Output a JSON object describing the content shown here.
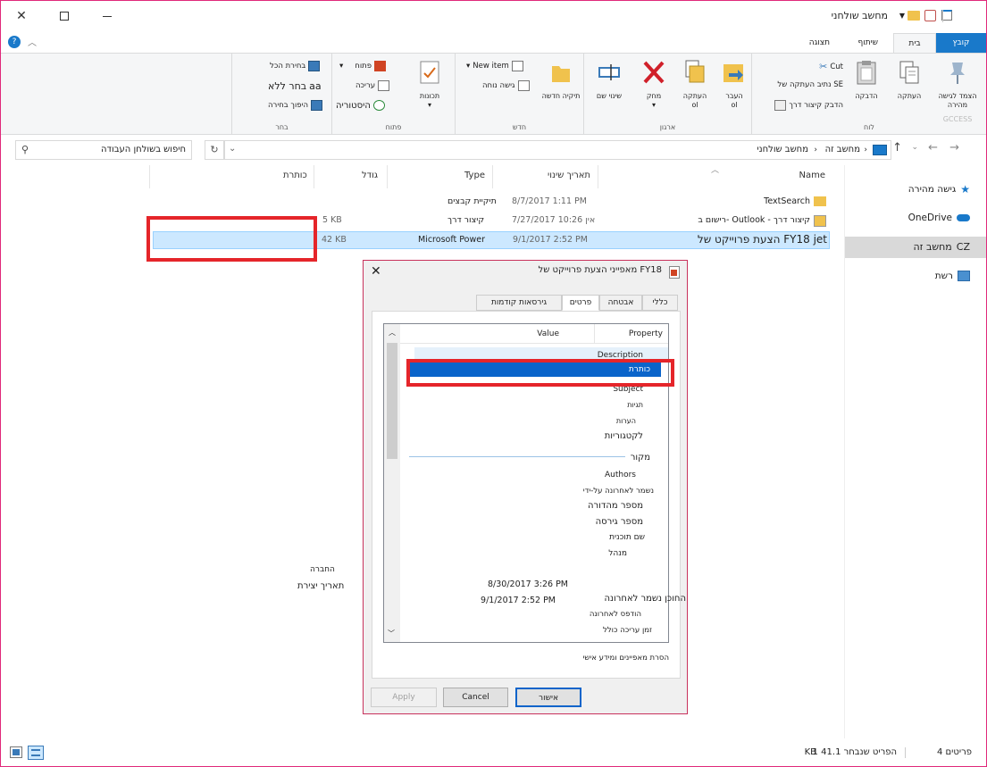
{
  "window": {
    "title": "מחשב שולחני"
  },
  "ribbon_tabs": [
    "קובץ",
    "בית",
    "שיתוף",
    "תצוגה"
  ],
  "ribbon": {
    "clipboard": {
      "pin_label": "הצמד לגישה מהירה",
      "copy_label": "העתקה",
      "paste_label": "הדבקה",
      "cut_label": "Cut",
      "copy_path_label": "נתיב העתקה של SE",
      "paste_shortcut_label": "הדבק קיצור דרך",
      "group_label": "לוח",
      "faded_code": "GCCESS"
    },
    "organize": {
      "move_label": "העבר",
      "move_to_label": "ol",
      "copy_to_label": "העתקה",
      "copy_to_sub": "ol",
      "delete_label": "מחק",
      "rename_label": "שינוי שם",
      "group_label": "ארגון"
    },
    "new": {
      "new_folder_label": "תיקיה חדשה",
      "new_item_label": "New item",
      "easy_access_label": "גישה נוחה",
      "group_label": "חדש"
    },
    "open": {
      "properties_label": "תכונות",
      "open_label": "פתוח",
      "edit_label": "עריכה",
      "history_label": "היסטוריה",
      "group_label": "פתוח"
    },
    "select": {
      "select_all_label": "בחירת הכל",
      "select_none_label": "בחר ללא",
      "invert_label": "היפוך בחירה",
      "group_label": "בחר",
      "aa": "aa"
    }
  },
  "address": {
    "path": [
      "מחשב זה",
      "מחשב שולחני"
    ],
    "search_placeholder": "חיפוש בשולחן העבודה"
  },
  "nav_pane": [
    {
      "label": "גישה מהירה",
      "icon": "star-icon"
    },
    {
      "label": "OneDrive",
      "icon": "cloud-icon"
    },
    {
      "label": "מחשב זה",
      "icon": "computer-icon",
      "prefix": "CZ"
    },
    {
      "label": "רשת",
      "icon": "network-icon"
    }
  ],
  "columns": {
    "name": "Name",
    "date": "תאריך שינוי",
    "type": "Type",
    "size": "גודל",
    "title": "כותרת"
  },
  "files": [
    {
      "name": "TextSearch",
      "date": "8/7/2017 1:11 PM",
      "type": "תיקיית קבצים",
      "size": ""
    },
    {
      "name": "רישום ב- Outlook - קיצור דרך",
      "date": "7/27/2017 אין 10:26",
      "type": "קיצור דרך",
      "size": "5 KB"
    },
    {
      "name": "הצעת פרוייקט של FY18 jet",
      "date": "9/1/2017 2:52 PM",
      "type": "Microsoft Power",
      "size": "42 KB"
    }
  ],
  "left_labels": {
    "company": "החברה",
    "created": "תאריך יצירת"
  },
  "dialog": {
    "title": "מאפייני הצעת פרוייקט של FY18",
    "tabs": [
      "כללי",
      "אבטחה",
      "פרטים",
      "גירסאות קודמות"
    ],
    "header_property": "Property",
    "header_value": "Value",
    "properties": [
      "Description",
      "כותרת",
      "Subject",
      "תגיות",
      "הערות",
      "לקטגוריות",
      "מקור",
      "Authors",
      "נשמר לאחרונה על-ידי",
      "מספר מהדורה",
      "מספר גירסה",
      "שם תוכנית",
      "מנהל",
      "",
      "החוכן נשמר לאחרונה",
      "הודפס לאחרונה",
      "זמן עריכה כולל"
    ],
    "dates": [
      "8/30/2017 3:26 PM",
      "9/1/2017 2:52 PM"
    ],
    "remove_link": "הסרת מאפיינים ומידע אישי",
    "ok": "אישור",
    "cancel": "Cancel",
    "apply": "Apply"
  },
  "status": {
    "items_count": "4 פריטים",
    "selected": "1 הפריט שנבחר 41.1",
    "kb": "KB"
  },
  "colors": {
    "accent": "#1979ca",
    "selection": "#cce8ff",
    "highlight": "#0a64ca",
    "red": "#e5252a"
  }
}
